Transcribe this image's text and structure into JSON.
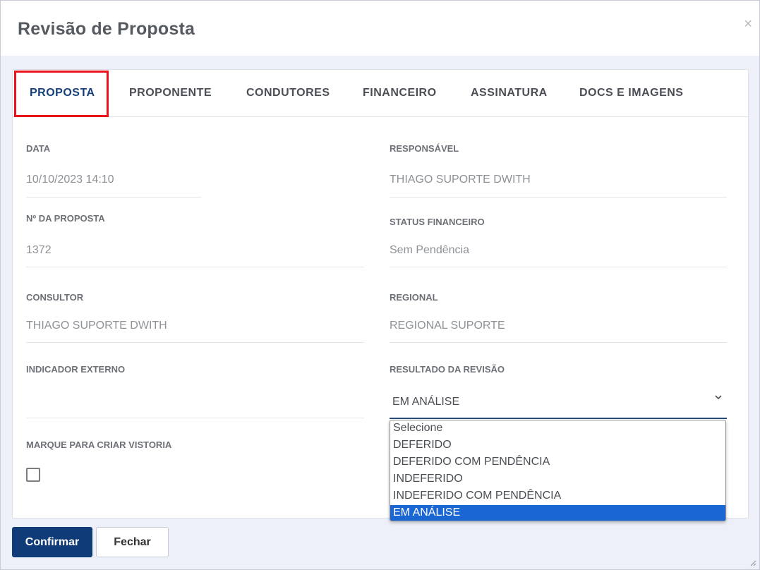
{
  "modal": {
    "title": "Revisão de Proposta",
    "close_label": "×"
  },
  "tabs": [
    {
      "label": "PROPOSTA",
      "active": true
    },
    {
      "label": "PROPONENTE"
    },
    {
      "label": "CONDUTORES"
    },
    {
      "label": "FINANCEIRO"
    },
    {
      "label": "ASSINATURA"
    },
    {
      "label": "DOCS E IMAGENS"
    }
  ],
  "fields": {
    "data": {
      "label": "DATA",
      "value": "10/10/2023 14:10"
    },
    "responsavel": {
      "label": "RESPONSÁVEL",
      "value": "THIAGO SUPORTE DWITH"
    },
    "numero_proposta": {
      "label": "Nº DA PROPOSTA",
      "value": "1372"
    },
    "status_financeiro": {
      "label": "STATUS FINANCEIRO",
      "value": "Sem Pendência"
    },
    "consultor": {
      "label": "CONSULTOR",
      "value": "THIAGO SUPORTE DWITH"
    },
    "regional": {
      "label": "REGIONAL",
      "value": "REGIONAL SUPORTE"
    },
    "indicador_externo": {
      "label": "INDICADOR EXTERNO",
      "value": ""
    },
    "resultado_revisao": {
      "label": "RESULTADO DA REVISÃO",
      "value": "EM ANÁLISE"
    },
    "criar_vistoria": {
      "label": "MARQUE PARA CRIAR VISTORIA",
      "checked": false
    }
  },
  "dropdown": {
    "options": [
      "Selecione",
      "DEFERIDO",
      "DEFERIDO COM PENDÊNCIA",
      "INDEFERIDO",
      "INDEFERIDO COM PENDÊNCIA",
      "EM ANÁLISE"
    ],
    "selected": "EM ANÁLISE"
  },
  "buttons": {
    "confirm": "Confirmar",
    "close": "Fechar"
  },
  "colors": {
    "primary": "#0f3c78",
    "active_tab": "#16407a",
    "highlight": "#e8141c",
    "selected_option": "#1a66d3"
  }
}
